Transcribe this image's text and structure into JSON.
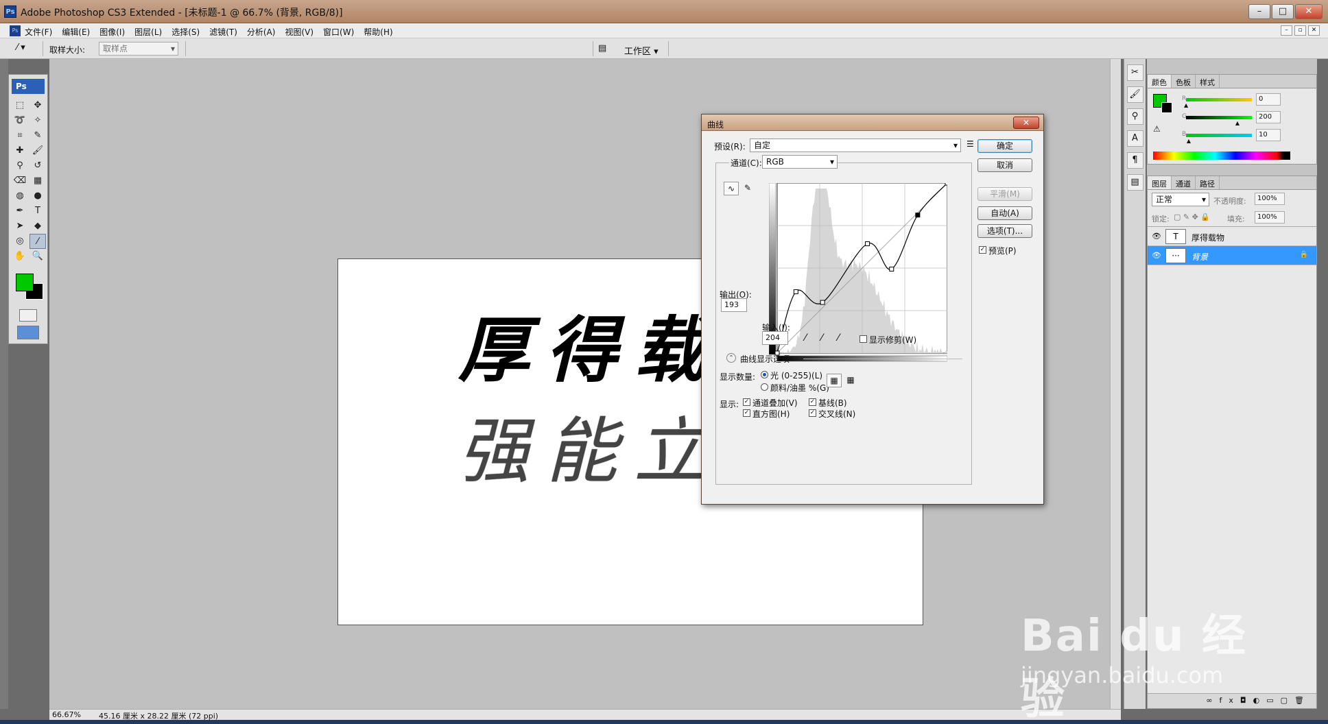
{
  "window": {
    "app_title": "Adobe Photoshop CS3 Extended - [未标题-1 @ 66.7% (背景, RGB/8)]",
    "app_icon": "Ps",
    "minimize": "–",
    "maximize": "□",
    "close": "✕"
  },
  "menu": {
    "icon": "Ps",
    "items": [
      "文件(F)",
      "编辑(E)",
      "图像(I)",
      "图层(L)",
      "选择(S)",
      "滤镜(T)",
      "分析(A)",
      "视图(V)",
      "窗口(W)",
      "帮助(H)"
    ],
    "doc_minimize": "–",
    "doc_restore": "▫",
    "doc_close": "✕"
  },
  "options": {
    "sample_size_label": "取样大小:",
    "sample_size_value": "取样点",
    "workspace_label": "工作区 ▾"
  },
  "document": {
    "line1": "厚得载物",
    "line2": "强能立业"
  },
  "toolbox": {
    "logo": "Ps",
    "tools": [
      {
        "name": "marquee-tool",
        "glyph": "⬚"
      },
      {
        "name": "move-tool",
        "glyph": "✥"
      },
      {
        "name": "lasso-tool",
        "glyph": "➰"
      },
      {
        "name": "magic-wand-tool",
        "glyph": "✧"
      },
      {
        "name": "crop-tool",
        "glyph": "⌗"
      },
      {
        "name": "slice-tool",
        "glyph": "✎"
      },
      {
        "name": "healing-tool",
        "glyph": "✚"
      },
      {
        "name": "brush-tool",
        "glyph": "🖌"
      },
      {
        "name": "stamp-tool",
        "glyph": "⚲"
      },
      {
        "name": "history-brush-tool",
        "glyph": "↺"
      },
      {
        "name": "eraser-tool",
        "glyph": "⌫"
      },
      {
        "name": "gradient-tool",
        "glyph": "▦"
      },
      {
        "name": "blur-tool",
        "glyph": "◍"
      },
      {
        "name": "dodge-tool",
        "glyph": "●"
      },
      {
        "name": "pen-tool",
        "glyph": "✒"
      },
      {
        "name": "type-tool",
        "glyph": "T"
      },
      {
        "name": "path-select-tool",
        "glyph": "➤"
      },
      {
        "name": "shape-tool",
        "glyph": "◆"
      },
      {
        "name": "3d-tool",
        "glyph": "◎"
      },
      {
        "name": "eyedropper-tool",
        "glyph": "⁄"
      },
      {
        "name": "hand-tool",
        "glyph": "✋"
      },
      {
        "name": "zoom-tool",
        "glyph": "🔍"
      }
    ]
  },
  "status": {
    "zoom": "66.67%",
    "dims": "45.16 厘米 x 28.22 厘米 (72 ppi)"
  },
  "color_panel": {
    "tabs": [
      "颜色",
      "色板",
      "样式"
    ],
    "r": "0",
    "g": "200",
    "b": "10",
    "r_label": "R",
    "g_label": "G",
    "b_label": "B",
    "r_level": 0,
    "g_level": 0.78,
    "b_level": 0.04
  },
  "layers_panel": {
    "tabs": [
      "图层",
      "通道",
      "路径"
    ],
    "blend_mode": "正常",
    "opacity_label": "不透明度:",
    "opacity": "100%",
    "lock_label": "锁定:",
    "fill_label": "填充:",
    "fill": "100%",
    "layers": [
      {
        "name": "厚得载物",
        "thumb": "T"
      },
      {
        "name": "背景",
        "thumb": "···"
      }
    ]
  },
  "dialog": {
    "title": "曲线",
    "close": "✕",
    "preset_label": "预设(R):",
    "preset_value": "自定",
    "channel_label": "通道(C):",
    "channel_value": "RGB",
    "ok": "确定",
    "cancel": "取消",
    "smooth": "平滑(M)",
    "auto": "自动(A)",
    "options": "选项(T)...",
    "preview_label": "预览(P)",
    "output_label": "输出(O):",
    "output_value": "193",
    "input_label": "输入(I):",
    "input_value": "204",
    "show_clipping": "显示修剪(W)",
    "display_options": "曲线显示选项",
    "show_amount_label": "显示数量:",
    "light_option": "光 (0-255)(L)",
    "pigment_option": "颜料/油墨 %(G)",
    "show_label": "显示:",
    "channel_overlay": "通道叠加(V)",
    "baseline": "基线(B)",
    "histogram": "直方图(H)",
    "intersection": "交叉线(N)",
    "curve_points": [
      [
        0,
        0
      ],
      [
        38,
        92
      ],
      [
        92,
        76
      ],
      [
        183,
        164
      ],
      [
        232,
        126
      ],
      [
        285,
        207
      ],
      [
        345,
        255
      ]
    ]
  },
  "watermark": {
    "brand": "Bai du 经验",
    "url": "jingyan.baidu.com"
  }
}
